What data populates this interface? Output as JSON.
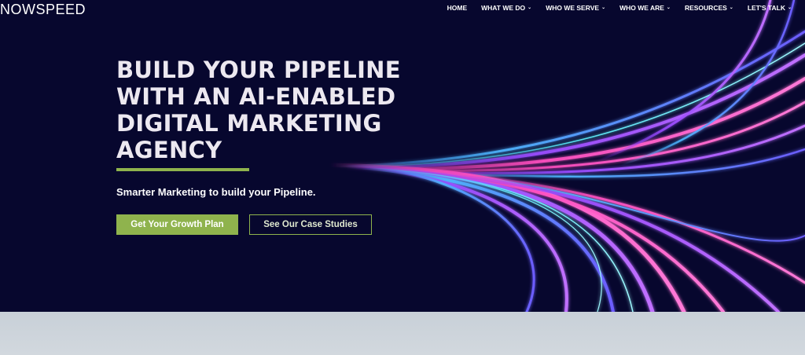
{
  "brand": {
    "logo_text": "NOWSPEED"
  },
  "nav": {
    "items": [
      {
        "label": "HOME",
        "has_dropdown": false
      },
      {
        "label": "WHAT WE DO",
        "has_dropdown": true
      },
      {
        "label": "WHO WE SERVE",
        "has_dropdown": true
      },
      {
        "label": "WHO WE ARE",
        "has_dropdown": true
      },
      {
        "label": "RESOURCES",
        "has_dropdown": true
      },
      {
        "label": "LET'S TALK",
        "has_dropdown": true
      }
    ],
    "chevron_glyph": "⌄"
  },
  "hero": {
    "headline_lines": [
      "BUILD YOUR PIPELINE",
      "WITH AN AI-ENABLED",
      "DIGITAL MARKETING",
      "AGENCY"
    ],
    "subline": "Smarter Marketing to build your Pipeline.",
    "primary_cta": "Get Your Growth Plan",
    "secondary_cta": "See Our Case Studies"
  },
  "colors": {
    "hero_bg": "#07072e",
    "accent_green": "#8fb34d",
    "headline_text": "#ece8f0",
    "below_fold": "#c9d0d8"
  }
}
